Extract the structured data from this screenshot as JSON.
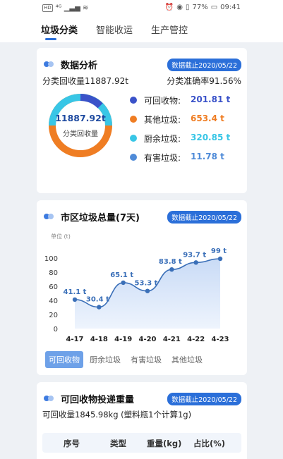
{
  "status_bar": {
    "sim_label": "HD",
    "signal_glyphs": "⁴ᴳ ▁▃▅ ≋",
    "battery": "77%",
    "time": "09:41"
  },
  "tabs": [
    {
      "label": "垃圾分类",
      "active": true
    },
    {
      "label": "智能收运",
      "active": false
    },
    {
      "label": "生产管控",
      "active": false
    }
  ],
  "analysis": {
    "title": "数据分析",
    "date_badge": "数据截止2020/05/22",
    "recycle_total": "分类回收量11887.92t",
    "accuracy": "分类准确率91.56%",
    "donut_value": "11887.92t",
    "donut_label": "分类回收量",
    "legend": [
      {
        "label": "可回收物:",
        "value": "201.81 t",
        "color": "#3a52c9"
      },
      {
        "label": "其他垃圾:",
        "value": "653.4 t",
        "color": "#ef7d23"
      },
      {
        "label": "厨余垃圾:",
        "value": "320.85 t",
        "color": "#38c6e6"
      },
      {
        "label": "有害垃圾:",
        "value": "11.78 t",
        "color": "#4f8bd8"
      }
    ]
  },
  "city_total": {
    "title": "市区垃圾总量(7天)",
    "date_badge": "数据截止2020/05/22",
    "segments": [
      {
        "label": "可回收物",
        "active": true
      },
      {
        "label": "厨余垃圾",
        "active": false
      },
      {
        "label": "有害垃圾",
        "active": false
      },
      {
        "label": "其他垃圾",
        "active": false
      }
    ]
  },
  "chart_data": {
    "type": "area",
    "unit_label": "单位 (t)",
    "categories": [
      "4-17",
      "4-18",
      "4-19",
      "4-20",
      "4-21",
      "4-22",
      "4-23"
    ],
    "values": [
      41.1,
      30.4,
      65.1,
      53.3,
      83.8,
      93.7,
      99
    ],
    "data_labels": [
      "41.1 t",
      "30.4 t",
      "65.1 t",
      "53.3 t",
      "83.8 t",
      "93.7 t",
      "99 t"
    ],
    "yticks": [
      "0",
      "20",
      "40",
      "60",
      "80",
      "100"
    ],
    "ylim": [
      0,
      100
    ]
  },
  "recyclable_weight": {
    "title": "可回收物投递重量",
    "date_badge": "数据截止2020/05/22",
    "summary": "可回收量1845.98kg (塑料瓶1个计算1g)",
    "columns": [
      "序号",
      "类型",
      "重量(kg)",
      "占比(%)"
    ]
  }
}
